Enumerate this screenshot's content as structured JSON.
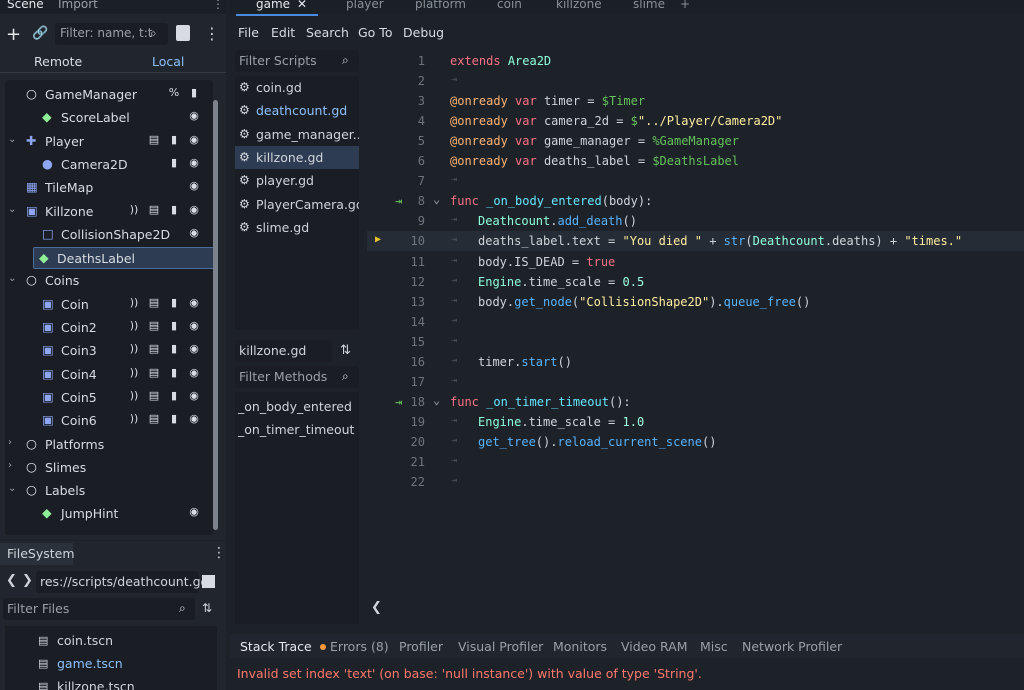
{
  "dock": {
    "tab_scene": "Scene",
    "tab_import": "Import"
  },
  "scene": {
    "filter_placeholder": "Filter: name, t:t",
    "remote": "Remote",
    "local": "Local"
  },
  "tree": [
    {
      "label": "GameManager",
      "depth": 0,
      "icon": "node-circle",
      "arrow": "",
      "flags": [
        "percent",
        "script"
      ]
    },
    {
      "label": "ScoreLabel",
      "depth": 1,
      "icon": "label-icon",
      "arrow": "",
      "flags": [
        "eye"
      ]
    },
    {
      "label": "Player",
      "depth": 0,
      "icon": "character-icon",
      "arrow": "down",
      "flags": [
        "clapper",
        "script",
        "eye"
      ]
    },
    {
      "label": "Camera2D",
      "depth": 1,
      "icon": "camera-icon",
      "arrow": "",
      "flags": [
        "script",
        "eye"
      ]
    },
    {
      "label": "TileMap",
      "depth": 0,
      "icon": "tilemap-icon",
      "arrow": "",
      "flags": [
        "eye"
      ]
    },
    {
      "label": "Killzone",
      "depth": 0,
      "icon": "area-icon",
      "arrow": "down",
      "flags": [
        "signal",
        "clapper",
        "script",
        "eye"
      ]
    },
    {
      "label": "CollisionShape2D",
      "depth": 1,
      "icon": "collision-icon",
      "arrow": "",
      "flags": [
        "eye"
      ]
    },
    {
      "label": "DeathsLabel",
      "depth": 1,
      "icon": "label-icon",
      "arrow": "",
      "flags": [
        "eye"
      ],
      "selected": true
    },
    {
      "label": "Coins",
      "depth": 0,
      "icon": "node-circle",
      "arrow": "down",
      "flags": []
    },
    {
      "label": "Coin",
      "depth": 1,
      "icon": "area-icon",
      "arrow": "",
      "flags": [
        "signal",
        "clapper",
        "script",
        "eye"
      ]
    },
    {
      "label": "Coin2",
      "depth": 1,
      "icon": "area-icon",
      "arrow": "",
      "flags": [
        "signal",
        "clapper",
        "script",
        "eye"
      ]
    },
    {
      "label": "Coin3",
      "depth": 1,
      "icon": "area-icon",
      "arrow": "",
      "flags": [
        "signal",
        "clapper",
        "script",
        "eye"
      ]
    },
    {
      "label": "Coin4",
      "depth": 1,
      "icon": "area-icon",
      "arrow": "",
      "flags": [
        "signal",
        "clapper",
        "script",
        "eye"
      ]
    },
    {
      "label": "Coin5",
      "depth": 1,
      "icon": "area-icon",
      "arrow": "",
      "flags": [
        "signal",
        "clapper",
        "script",
        "eye"
      ]
    },
    {
      "label": "Coin6",
      "depth": 1,
      "icon": "area-icon",
      "arrow": "",
      "flags": [
        "signal",
        "clapper",
        "script",
        "eye"
      ]
    },
    {
      "label": "Platforms",
      "depth": 0,
      "icon": "node-circle",
      "arrow": "right",
      "flags": []
    },
    {
      "label": "Slimes",
      "depth": 0,
      "icon": "node-circle",
      "arrow": "right",
      "flags": []
    },
    {
      "label": "Labels",
      "depth": 0,
      "icon": "node-circle",
      "arrow": "down",
      "flags": []
    },
    {
      "label": "JumpHint",
      "depth": 1,
      "icon": "label-icon",
      "arrow": "",
      "flags": [
        "eye"
      ]
    }
  ],
  "filesystem": {
    "title": "FileSystem",
    "path": "res://scripts/deathcount.gd",
    "filter_placeholder": "Filter Files",
    "files": [
      "coin.tscn",
      "game.tscn",
      "killzone.tscn"
    ]
  },
  "scene_tabs": [
    "game",
    "player",
    "platform",
    "coin",
    "killzone",
    "slime"
  ],
  "menu": [
    "File",
    "Edit",
    "Search",
    "Go To",
    "Debug"
  ],
  "scripts": {
    "filter_placeholder": "Filter Scripts",
    "items": [
      "coin.gd",
      "deathcount.gd",
      "game_manager....",
      "killzone.gd",
      "player.gd",
      "PlayerCamera.gd",
      "slime.gd"
    ],
    "current": "killzone.gd"
  },
  "methods": {
    "filter_placeholder": "Filter Methods",
    "items": [
      "_on_body_entered",
      "_on_timer_timeout"
    ]
  },
  "code": {
    "lines": [
      "extends Area2D",
      "",
      "@onready var timer = $Timer",
      "@onready var camera_2d = $\"../Player/Camera2D\"",
      "@onready var game_manager = %GameManager",
      "@onready var deaths_label = $DeathsLabel",
      "",
      "func _on_body_entered(body):",
      "\tDeathcount.add_death()",
      "\tdeaths_label.text = \"You died \" + str(Deathcount.deaths) + \"times.\"",
      "\tbody.IS_DEAD = true",
      "\tEngine.time_scale = 0.5",
      "\tbody.get_node(\"CollisionShape2D\").queue_free()",
      "",
      "",
      "\ttimer.start()",
      "",
      "func _on_timer_timeout():",
      "\tEngine.time_scale = 1.0",
      "\tget_tree().reload_current_scene()",
      "",
      ""
    ],
    "current_line": 10
  },
  "bottom_tabs": [
    "Stack Trace",
    "Errors (8)",
    "Profiler",
    "Visual Profiler",
    "Monitors",
    "Video RAM",
    "Misc",
    "Network Profiler"
  ],
  "error": "Invalid set index 'text' (on base: 'null instance') with value of type 'String'.",
  "colors": {
    "accent": "#4b6e9c",
    "error": "#ff786b",
    "keyword": "#ff7085",
    "string": "#ffeda1",
    "function": "#57b3ff"
  }
}
